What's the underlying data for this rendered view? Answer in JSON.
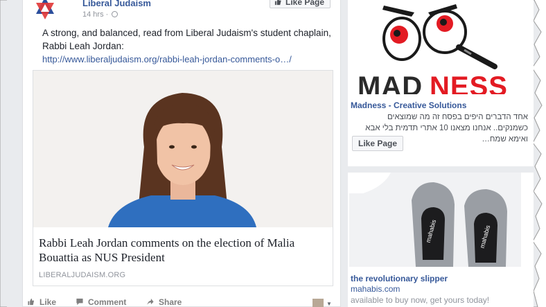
{
  "post": {
    "page_name": "Liberal Judaism",
    "time": "14 hrs",
    "like_page_label": "Like Page",
    "text": "A strong, and balanced, read from Liberal Judaism's student chaplain, Rabbi Leah Jordan:",
    "link": "http://www.liberaljudaism.org/rabbi-leah-jordan-comments-o…/",
    "card": {
      "title": "Rabbi Leah Jordan comments on the election of Malia Bouattia as NUS President",
      "domain": "LIBERALJUDAISM.ORG"
    },
    "actions": {
      "like": "Like",
      "comment": "Comment",
      "share": "Share"
    }
  },
  "ads": [
    {
      "logo_text": "MADNESS",
      "title": "Madness - Creative Solutions",
      "description": "אחד הדברים היפים בפסח זה מה שמוצאים כשמנקים.. אנחנו מצאנו 10 אתרי תדמית בלי אבא ואימא שמח…",
      "button_label": "Like Page"
    },
    {
      "title": "the revolutionary slipper",
      "domain": "mahabis.com",
      "description": "available to buy now, get yours today!",
      "brand_mark": "mahabis"
    }
  ],
  "colors": {
    "link_blue": "#365899",
    "background": "#e9ebee",
    "logo_red": "#e31b23",
    "star_blue": "#2b4e9c",
    "star_red": "#e23a3a"
  },
  "icons": [
    "star-of-david-logo-icon",
    "globe-icon",
    "thumbs-up-icon",
    "comment-icon",
    "share-icon",
    "chevron-down-icon",
    "magnifying-glass-icon"
  ]
}
